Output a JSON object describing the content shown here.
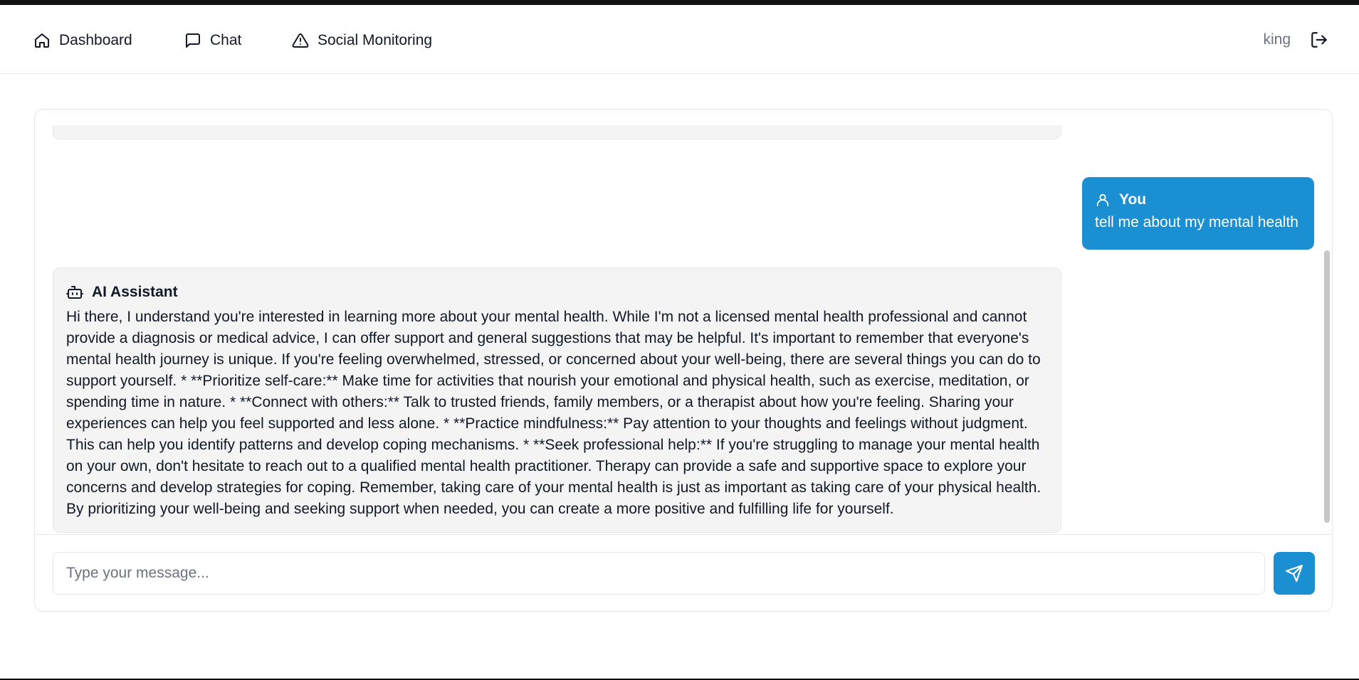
{
  "nav": {
    "items": [
      {
        "label": "Dashboard",
        "icon": "home-icon"
      },
      {
        "label": "Chat",
        "icon": "message-square-icon"
      },
      {
        "label": "Social Monitoring",
        "icon": "alert-triangle-icon"
      }
    ],
    "user_name": "king",
    "logout_icon": "logout-icon"
  },
  "chat": {
    "messages": [
      {
        "sender": "You",
        "icon": "user-icon",
        "text": "tell me about my mental health"
      },
      {
        "sender": "AI Assistant",
        "icon": "bot-icon",
        "text": "Hi there, I understand you're interested in learning more about your mental health. While I'm not a licensed mental health professional and cannot provide a diagnosis or medical advice, I can offer support and general suggestions that may be helpful. It's important to remember that everyone's mental health journey is unique. If you're feeling overwhelmed, stressed, or concerned about your well-being, there are several things you can do to support yourself. * **Prioritize self-care:** Make time for activities that nourish your emotional and physical health, such as exercise, meditation, or spending time in nature. * **Connect with others:** Talk to trusted friends, family members, or a therapist about how you're feeling. Sharing your experiences can help you feel supported and less alone. * **Practice mindfulness:** Pay attention to your thoughts and feelings without judgment. This can help you identify patterns and develop coping mechanisms. * **Seek professional help:** If you're struggling to manage your mental health on your own, don't hesitate to reach out to a qualified mental health practitioner. Therapy can provide a safe and supportive space to explore your concerns and develop strategies for coping. Remember, taking care of your mental health is just as important as taking care of your physical health. By prioritizing your well-being and seeking support when needed, you can create a more positive and fulfilling life for yourself."
      }
    ],
    "input": {
      "placeholder": "Type your message...",
      "value": ""
    },
    "send_icon": "send-icon"
  },
  "colors": {
    "accent": "#1a8fd1",
    "bubble_bg": "#f4f4f4",
    "border": "#e5e7eb"
  }
}
